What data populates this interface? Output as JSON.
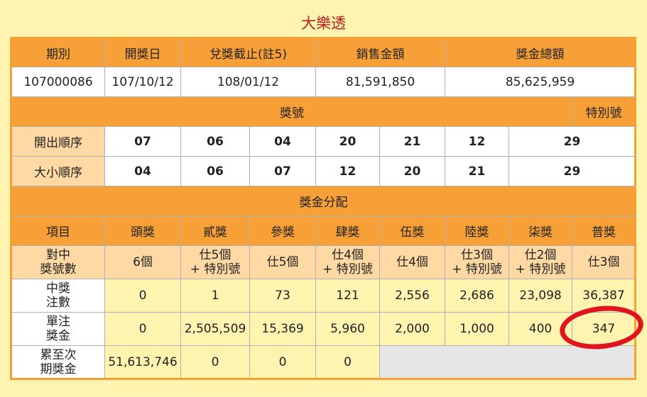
{
  "title": "大樂透",
  "info_headers": [
    "期別",
    "開獎日",
    "兌獎截止(註5)",
    "銷售金額",
    "獎金總額"
  ],
  "info_values": [
    "107000086",
    "107/10/12",
    "108/01/12",
    "81,591,850",
    "85,625,959"
  ],
  "numbers_header": "獎號",
  "special_header": "特別號",
  "draw_order": {
    "label": "開出順序",
    "numbers": [
      "07",
      "06",
      "04",
      "20",
      "21",
      "12"
    ],
    "special": "29"
  },
  "size_order": {
    "label": "大小順序",
    "numbers": [
      "04",
      "06",
      "07",
      "12",
      "20",
      "21"
    ],
    "special": "29"
  },
  "prize_header": "獎金分配",
  "prize_cols": [
    "項目",
    "頭獎",
    "貳獎",
    "參獎",
    "肆獎",
    "伍獎",
    "陸獎",
    "柒獎",
    "普獎"
  ],
  "match_row": {
    "label_line1": "對中",
    "label_line2": "獎號數",
    "cells": [
      {
        "l1": "6個",
        "l2": ""
      },
      {
        "l1": "仕5個",
        "l2": "+ 特別號"
      },
      {
        "l1": "仕5個",
        "l2": ""
      },
      {
        "l1": "仕4個",
        "l2": "+ 特別號"
      },
      {
        "l1": "仕4個",
        "l2": ""
      },
      {
        "l1": "仕3個",
        "l2": "+ 特別號"
      },
      {
        "l1": "仕2個",
        "l2": "+ 特別號"
      },
      {
        "l1": "仕3個",
        "l2": ""
      }
    ]
  },
  "winners_row": {
    "label_line1": "中獎",
    "label_line2": "注數",
    "values": [
      "0",
      "1",
      "73",
      "121",
      "2,556",
      "2,686",
      "23,098",
      "36,387"
    ]
  },
  "amount_row": {
    "label_line1": "單注",
    "label_line2": "獎金",
    "values": [
      "0",
      "2,505,509",
      "15,369",
      "5,960",
      "2,000",
      "1,000",
      "400",
      "347"
    ]
  },
  "carry_row": {
    "label_line1": "累至次",
    "label_line2": "期獎金",
    "values": [
      "51,613,746",
      "0",
      "0",
      "0"
    ]
  },
  "colors": {
    "header": "#f7a038",
    "light": "#ffd9a3",
    "special": "#c8102e",
    "ring": "#e0141e"
  }
}
